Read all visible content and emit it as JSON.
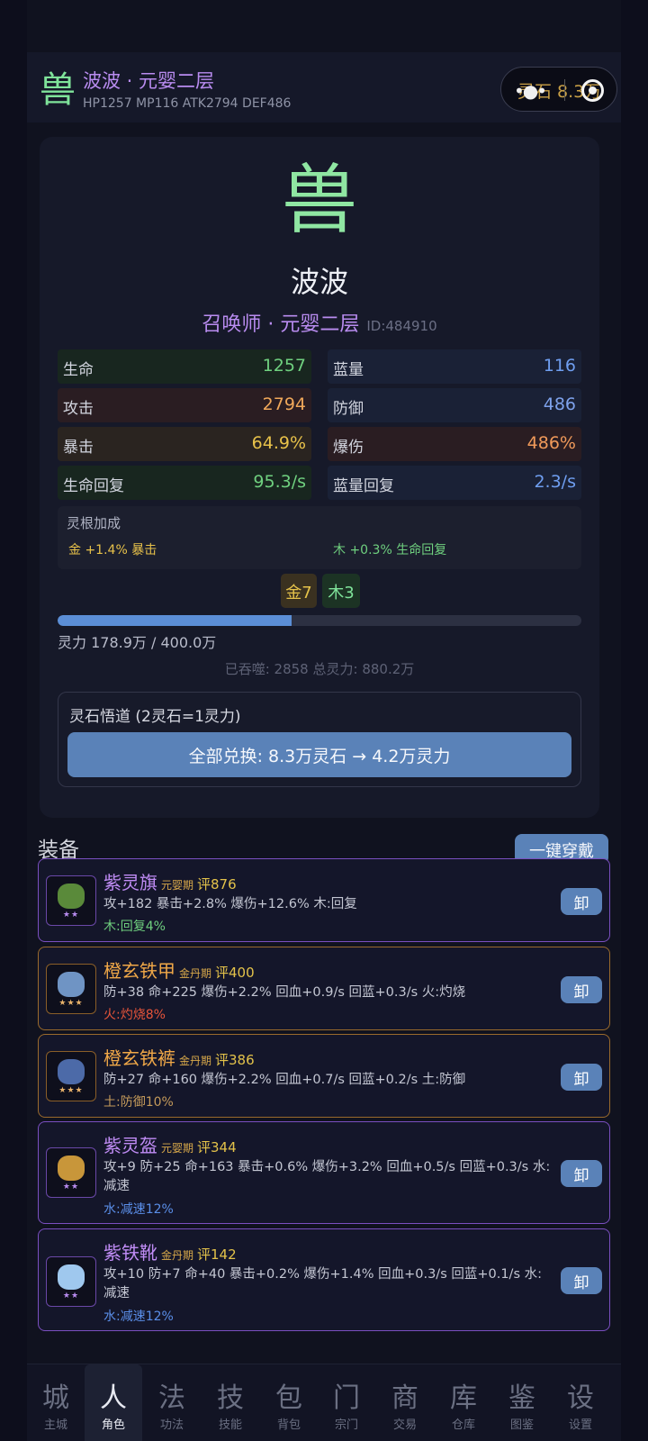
{
  "header": {
    "icon": "兽",
    "name": "波波 · 元婴二层",
    "stats": "HP1257 MP116 ATK2794 DEF486",
    "capsule_text": "灵石 8.3万"
  },
  "profile": {
    "icon": "兽",
    "name": "波波",
    "class": "召唤师 · 元婴二层",
    "id": "ID:484910",
    "stats": [
      {
        "label": "生命",
        "value": "1257",
        "color": "#6fd07f"
      },
      {
        "label": "蓝量",
        "value": "116",
        "color": "#6f9ef0"
      },
      {
        "label": "攻击",
        "value": "2794",
        "color": "#f0a85a"
      },
      {
        "label": "防御",
        "value": "486",
        "color": "#7ea2ec"
      },
      {
        "label": "暴击",
        "value": "64.9%",
        "color": "#e8c24a"
      },
      {
        "label": "爆伤",
        "value": "486%",
        "color": "#f09a5a"
      },
      {
        "label": "生命回复",
        "value": "95.3/s",
        "color": "#6fd07f"
      },
      {
        "label": "蓝量回复",
        "value": "2.3/s",
        "color": "#6f9ef0"
      }
    ],
    "lingen": {
      "title": "灵根加成",
      "gold_bonus": "金 +1.4% 暴击",
      "wood_bonus": "木 +0.3% 生命回复",
      "gold_badge": "金7",
      "wood_badge": "木3"
    },
    "power": {
      "progress": 0.447,
      "text": "灵力 178.9万 / 400.0万",
      "devoured": "已吞噬: 2858 总灵力: 880.2万"
    },
    "convert": {
      "title": "灵石悟道 (2灵石=1灵力)",
      "button": "全部兑换: 8.3万灵石 → 4.2万灵力"
    }
  },
  "equipment": {
    "title": "装备",
    "equip_all": "一键穿戴",
    "unequip": "卸",
    "items": [
      {
        "name": "紫灵旗",
        "tier": "元婴期",
        "score": "评876",
        "stars": "★★",
        "attrs": "攻+182 暴击+2.8% 爆伤+12.6% 木:回复",
        "effect": "木:回复4%",
        "effect_color": "#6fd07f",
        "icon_color": "#5a8a3a"
      },
      {
        "name": "橙玄铁甲",
        "tier": "金丹期",
        "score": "评400",
        "stars": "★★★",
        "attrs": "防+38 命+225 爆伤+2.2% 回血+0.9/s 回蓝+0.3/s 火:灼烧",
        "effect": "火:灼烧8%",
        "effect_color": "#e8553a",
        "icon_color": "#6f94c4"
      },
      {
        "name": "橙玄铁裤",
        "tier": "金丹期",
        "score": "评386",
        "stars": "★★★",
        "attrs": "防+27 命+160 爆伤+2.2% 回血+0.7/s 回蓝+0.2/s 土:防御",
        "effect": "土:防御10%",
        "effect_color": "#c49a5a",
        "icon_color": "#4c6aa8"
      },
      {
        "name": "紫灵盔",
        "tier": "元婴期",
        "score": "评344",
        "stars": "★★",
        "attrs": "攻+9 防+25 命+163 暴击+0.6% 爆伤+3.2% 回血+0.5/s 回蓝+0.3/s 水:减速",
        "effect": "水:减速12%",
        "effect_color": "#5a8ee8",
        "icon_color": "#c8963a"
      },
      {
        "name": "紫铁靴",
        "tier": "金丹期",
        "score": "评142",
        "stars": "★★",
        "attrs": "攻+10 防+7 命+40 暴击+0.2% 爆伤+1.4% 回血+0.3/s 回蓝+0.1/s 水:减速",
        "effect": "水:减速12%",
        "effect_color": "#5a8ee8",
        "icon_color": "#9fc8ee"
      }
    ]
  },
  "nav": [
    {
      "glyph": "城",
      "label": "主城"
    },
    {
      "glyph": "人",
      "label": "角色"
    },
    {
      "glyph": "法",
      "label": "功法"
    },
    {
      "glyph": "技",
      "label": "技能"
    },
    {
      "glyph": "包",
      "label": "背包"
    },
    {
      "glyph": "门",
      "label": "宗门"
    },
    {
      "glyph": "商",
      "label": "交易"
    },
    {
      "glyph": "库",
      "label": "仓库"
    },
    {
      "glyph": "鉴",
      "label": "图鉴"
    },
    {
      "glyph": "设",
      "label": "设置"
    }
  ]
}
